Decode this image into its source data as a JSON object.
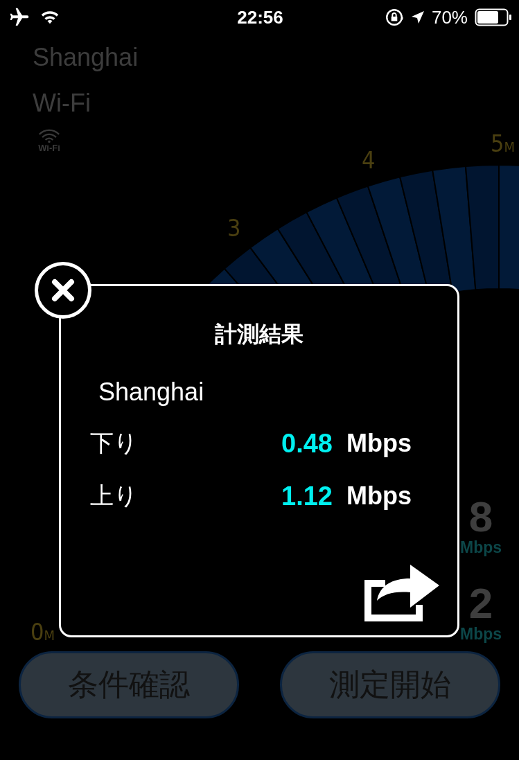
{
  "status_bar": {
    "time": "22:56",
    "battery": "70%"
  },
  "background": {
    "location": "Shanghai",
    "network": "Wi-Fi",
    "network_icon_label": "Wi-Fi",
    "gauge_ticks": [
      {
        "value": "3"
      },
      {
        "value": "4"
      },
      {
        "value": "5",
        "unit": "M"
      }
    ],
    "gauge_min": {
      "value": "0",
      "unit": "M"
    },
    "readings": [
      {
        "value": "8",
        "unit": "Mbps"
      },
      {
        "value": "2",
        "unit": "Mbps"
      }
    ]
  },
  "buttons": [
    {
      "label": "条件確認"
    },
    {
      "label": "測定開始"
    }
  ],
  "dialog": {
    "title": "計測結果",
    "location": "Shanghai",
    "rows": [
      {
        "label": "下り",
        "value": "0.48",
        "unit": "Mbps"
      },
      {
        "label": "上り",
        "value": "1.12",
        "unit": "Mbps"
      }
    ]
  }
}
